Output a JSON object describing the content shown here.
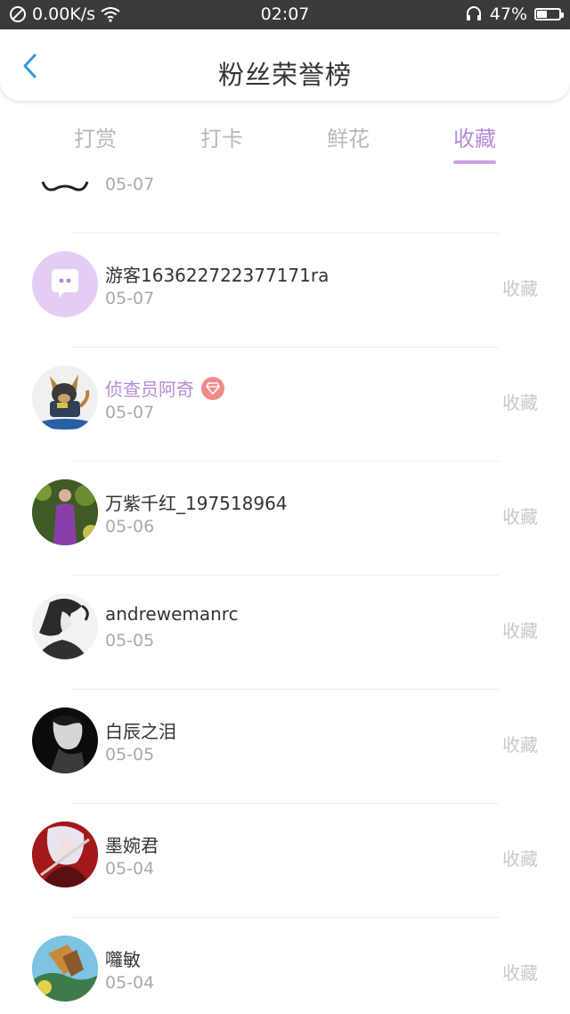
{
  "status_bar": {
    "network_speed": "0.00K/s",
    "time": "02:07",
    "battery_percent": "47%",
    "battery_level": 0.47
  },
  "header": {
    "title": "粉丝荣誉榜"
  },
  "tabs": [
    {
      "label": "打赏",
      "active": false
    },
    {
      "label": "打卡",
      "active": false
    },
    {
      "label": "鲜花",
      "active": false
    },
    {
      "label": "收藏",
      "active": true
    }
  ],
  "partial_item": {
    "date": "05-07"
  },
  "items": [
    {
      "name": "游客163622722377171ra",
      "date": "05-07",
      "action": "收藏",
      "avatar": "chat-bubble-avatar"
    },
    {
      "name": "侦查员阿奇",
      "date": "05-07",
      "action": "收藏",
      "avatar": "dog-avatar",
      "vip": true
    },
    {
      "name": "万紫千红_197518964",
      "date": "05-06",
      "action": "收藏",
      "avatar": "photo-avatar"
    },
    {
      "name": "andrewemanrc",
      "date": "05-05",
      "action": "收藏",
      "avatar": "sketch-avatar"
    },
    {
      "name": "白辰之泪",
      "date": "05-05",
      "action": "收藏",
      "avatar": "dark-portrait-avatar"
    },
    {
      "name": "墨婉君",
      "date": "05-04",
      "action": "收藏",
      "avatar": "anime-avatar"
    },
    {
      "name": "囖敏",
      "date": "05-04",
      "action": "收藏",
      "avatar": "game-avatar"
    }
  ],
  "colors": {
    "accent": "#b78ad6",
    "vip_badge": "#f18a8a",
    "back_arrow": "#2f9be0"
  }
}
